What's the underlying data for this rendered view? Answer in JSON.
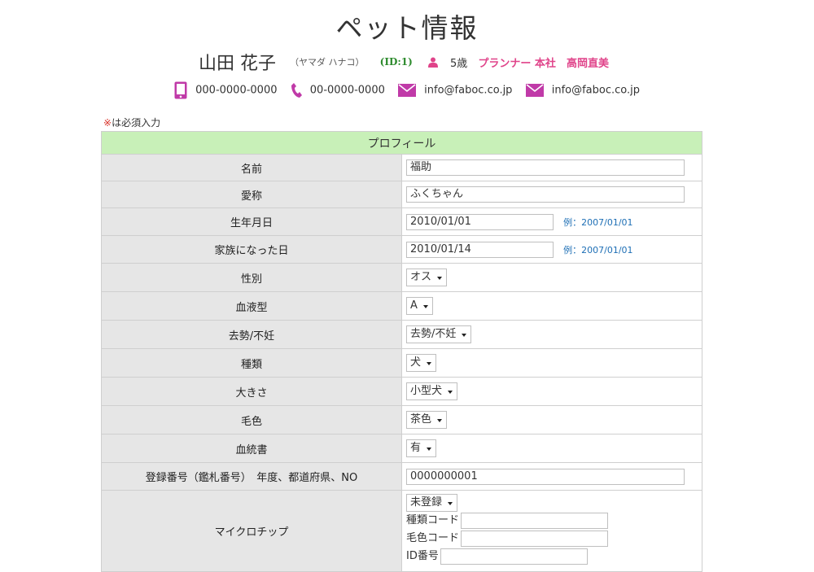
{
  "page": {
    "title": "ペット情報"
  },
  "owner": {
    "name": "山田 花子",
    "kana": "（ヤマダ ハナコ）",
    "id": "(ID:1)",
    "age": "5歳",
    "role": "プランナー 本社",
    "staff": "高岡直美"
  },
  "contacts": {
    "mobile": "000-0000-0000",
    "phone": "00-0000-0000",
    "email1": "info@faboc.co.jp",
    "email2": "info@faboc.co.jp"
  },
  "required_note": {
    "mark": "※",
    "text": "は必須入力"
  },
  "profile": {
    "section_title": "プロフィール",
    "rows": {
      "name": {
        "label": "名前",
        "value": "福助"
      },
      "nickname": {
        "label": "愛称",
        "value": "ふくちゃん"
      },
      "birthday": {
        "label": "生年月日",
        "value": "2010/01/01",
        "example": "例：2007/01/01"
      },
      "family_day": {
        "label": "家族になった日",
        "value": "2010/01/14",
        "example": "例：2007/01/01"
      },
      "sex": {
        "label": "性別",
        "value": "オス"
      },
      "blood": {
        "label": "血液型",
        "value": "A"
      },
      "neuter": {
        "label": "去勢/不妊",
        "value": "去勢/不妊"
      },
      "kind": {
        "label": "種類",
        "value": "犬"
      },
      "size": {
        "label": "大きさ",
        "value": "小型犬"
      },
      "color": {
        "label": "毛色",
        "value": "茶色"
      },
      "pedigree": {
        "label": "血統書",
        "value": "有"
      },
      "registration": {
        "label": "登録番号（鑑札番号）　年度、都道府県、NO",
        "value": "0000000001"
      },
      "microchip": {
        "label": "マイクロチップ",
        "status": "未登録",
        "kind_code_label": "種類コード",
        "color_code_label": "毛色コード",
        "id_label": "ID番号"
      }
    }
  },
  "colors": {
    "section_bg": "#c8f0b8",
    "label_bg": "#e6e6e6",
    "accent_pink": "#e0448a",
    "icon_magenta": "#c03aa8",
    "link_blue": "#1e6fb5",
    "id_green": "#2e8b2e"
  }
}
